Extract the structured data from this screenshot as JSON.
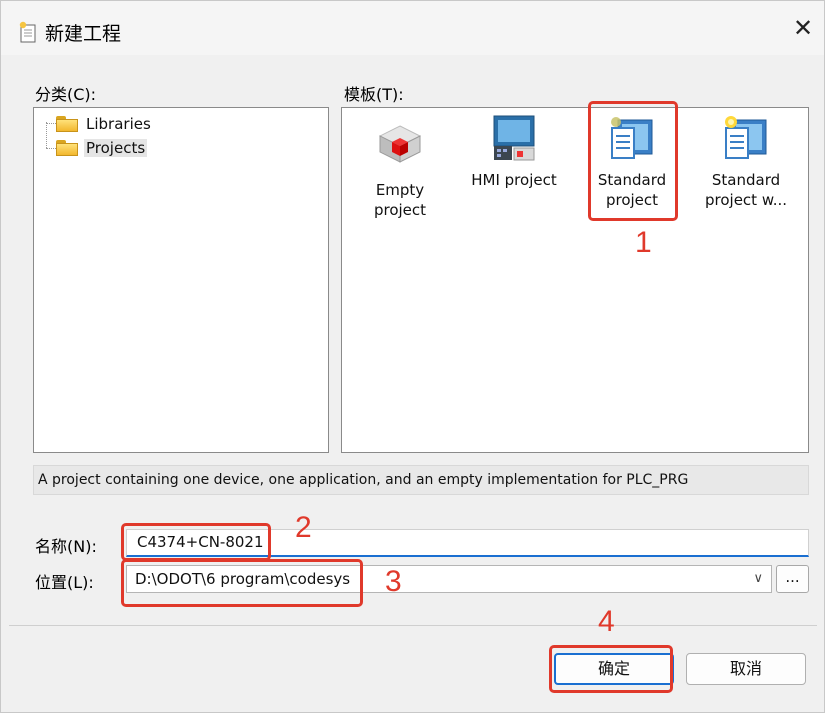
{
  "window": {
    "title": "新建工程",
    "close_icon": "close-icon",
    "close_glyph": "✕"
  },
  "category": {
    "label": "分类(C):",
    "items": [
      {
        "label": "Libraries",
        "icon": "folder-icon",
        "selected": false
      },
      {
        "label": "Projects",
        "icon": "folder-icon",
        "selected": true
      }
    ]
  },
  "templates": {
    "label": "模板(T):",
    "items": [
      {
        "label_line1": "Empty project",
        "label_line2": "",
        "icon": "red-cube-icon"
      },
      {
        "label_line1": "HMI project",
        "label_line2": "",
        "icon": "hmi-panel-icon"
      },
      {
        "label_line1": "Standard",
        "label_line2": "project",
        "icon": "standard-project-icon"
      },
      {
        "label_line1": "Standard",
        "label_line2": "project w...",
        "icon": "standard-project-wizard-icon"
      }
    ]
  },
  "description": "A project containing one device, one application, and an empty implementation for PLC_PRG",
  "name_field": {
    "label": "名称(N):",
    "value": "C4374+CN-8021"
  },
  "location_field": {
    "label": "位置(L):",
    "value": "D:\\ODOT\\6 program\\codesys",
    "dropdown_icon": "chevron-down-icon",
    "chevron": "∨",
    "browse_label": "..."
  },
  "buttons": {
    "ok": "确定",
    "cancel": "取消"
  },
  "annotations": {
    "step1": "1",
    "step2": "2",
    "step3": "3",
    "step4": "4",
    "color": "#e0392b"
  }
}
